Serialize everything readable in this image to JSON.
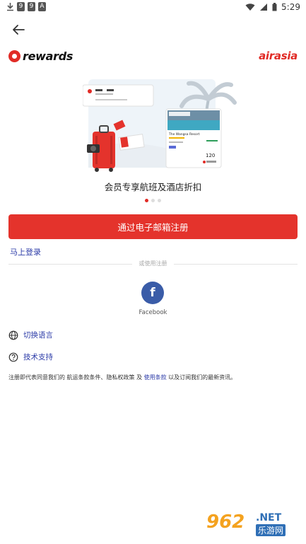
{
  "status_bar": {
    "left_icons": [
      "download-icon",
      "9",
      "9",
      "A"
    ],
    "time": "5:29"
  },
  "brand": {
    "rewards_logo_text": "rewards",
    "airasia_logo_text": "airasia",
    "accent_color": "#e12b26"
  },
  "hero": {
    "caption": "会员专享航班及酒店折扣",
    "card_title": "The Wangsa Resort",
    "card_price": "120",
    "pages": 3,
    "active_page": 1
  },
  "actions": {
    "signup_email_label": "通过电子邮箱注册",
    "login_label": "马上登录",
    "divider_text": "或使用注册",
    "facebook_label": "Facebook"
  },
  "menu": {
    "switch_language": "切换语言",
    "tech_support": "技术支持"
  },
  "terms": {
    "prefix": "注册即代表同意我们的 航运条款条件、隐私权政策 及 ",
    "link": "使用条款",
    "suffix": " 以及订阅我们的最新资讯。"
  },
  "watermark": {
    "number": "962",
    "domain": ".NET",
    "site_name": "乐游网"
  }
}
